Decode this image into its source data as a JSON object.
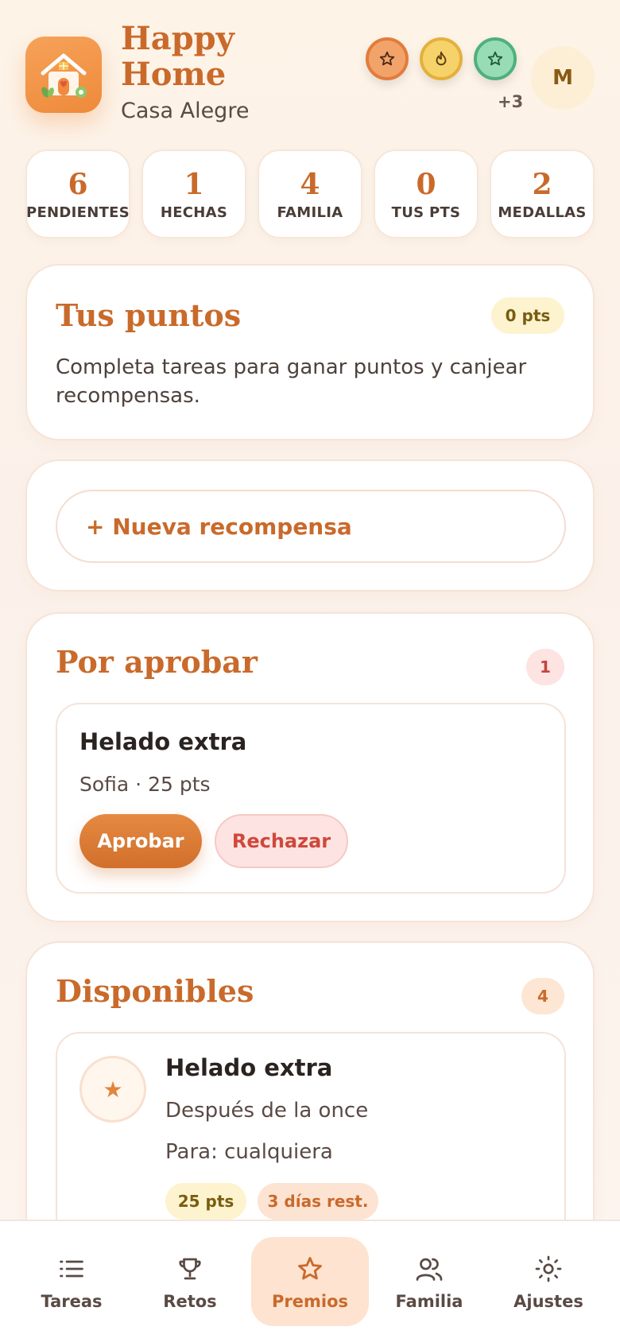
{
  "app": {
    "title": "Happy Home",
    "subtitle": "Casa Alegre"
  },
  "header": {
    "medals": [
      {
        "icon": "star-icon",
        "color": "#e27c3b"
      },
      {
        "icon": "flame-icon",
        "color": "#e4b03a"
      },
      {
        "icon": "star-icon",
        "color": "#4fb07b"
      }
    ],
    "medals_more": "+3",
    "avatar_initial": "M"
  },
  "stats": [
    {
      "value": "6",
      "label": "PENDIENTES"
    },
    {
      "value": "1",
      "label": "HECHAS"
    },
    {
      "value": "4",
      "label": "FAMILIA"
    },
    {
      "value": "0",
      "label": "TUS PTS"
    },
    {
      "value": "2",
      "label": "MEDALLAS"
    }
  ],
  "points_card": {
    "title": "Tus puntos",
    "badge": "0 pts",
    "description": "Completa tareas para ganar puntos y canjear recompensas."
  },
  "new_reward": {
    "label": "+ Nueva recompensa"
  },
  "pending": {
    "title": "Por aprobar",
    "count": "1",
    "items": [
      {
        "title": "Helado extra",
        "meta": "Sofia · 25 pts",
        "approve": "Aprobar",
        "reject": "Rechazar"
      }
    ]
  },
  "available": {
    "title": "Disponibles",
    "count": "4",
    "items": [
      {
        "icon": "star-icon",
        "title": "Helado extra",
        "description": "Después de la once",
        "for": "Para: cualquiera",
        "points": "25 pts",
        "remaining": "3 días rest."
      }
    ]
  },
  "nav": [
    {
      "label": "Tareas",
      "icon": "list-icon",
      "active": false
    },
    {
      "label": "Retos",
      "icon": "trophy-icon",
      "active": false
    },
    {
      "label": "Premios",
      "icon": "star-icon",
      "active": true
    },
    {
      "label": "Familia",
      "icon": "users-icon",
      "active": false
    },
    {
      "label": "Ajustes",
      "icon": "sun-icon",
      "active": false
    }
  ],
  "colors": {
    "accent": "#c96a2b",
    "accent_button": "#d16f2b",
    "reject": "#d0483c",
    "background": "#fdf3e7"
  }
}
